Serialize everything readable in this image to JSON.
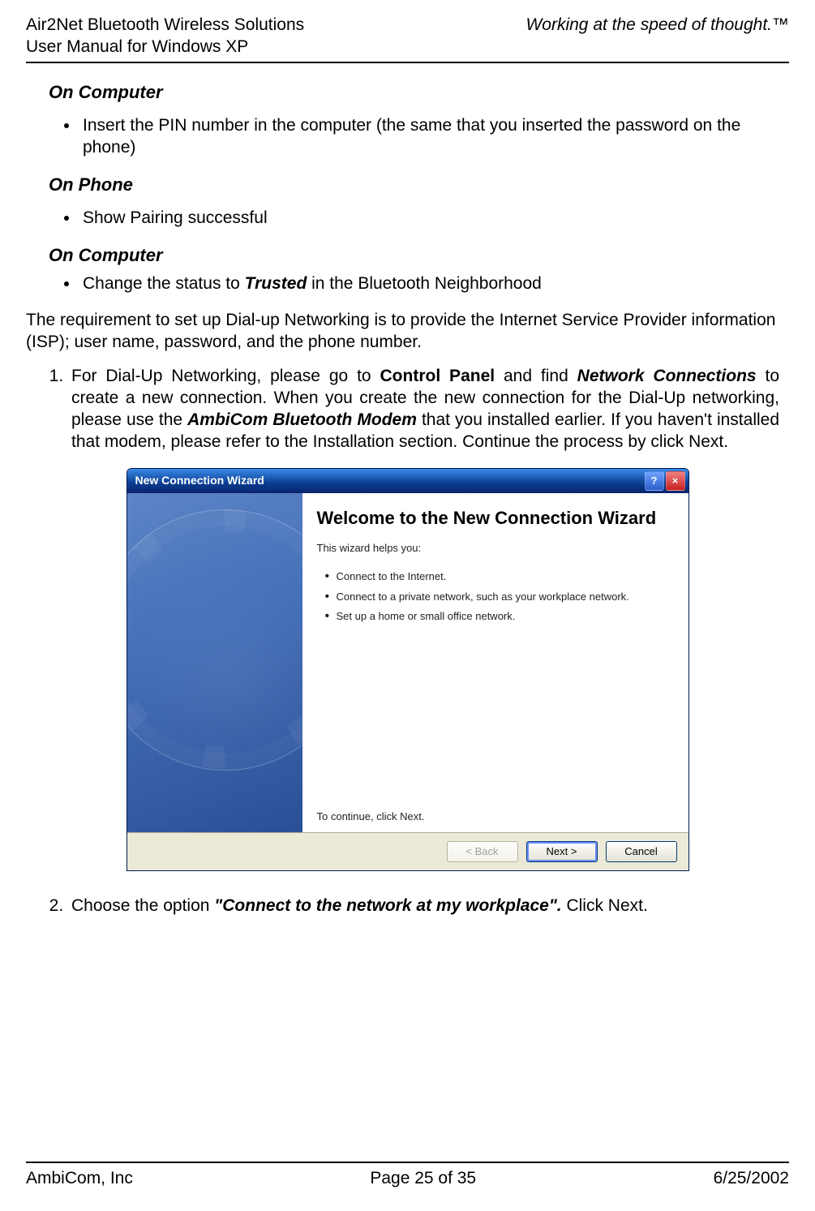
{
  "header": {
    "left_line1": "Air2Net Bluetooth Wireless Solutions",
    "left_line2": "User Manual for Windows XP",
    "right_tagline": "Working at the speed of thought.™"
  },
  "footer": {
    "company": "AmbiCom, Inc",
    "page_of": "Page 25 of 35",
    "date": "6/25/2002"
  },
  "sections": {
    "on_computer_1": "On Computer",
    "on_phone": "On Phone",
    "on_computer_2": "On Computer"
  },
  "bullets": {
    "comp1_a": "Insert the PIN number in the computer (the same that you inserted the password on the phone)",
    "phone_a": "Show Pairing successful",
    "comp2_prefix": "Change the status to ",
    "comp2_bold": "Trusted",
    "comp2_suffix": " in the Bluetooth Neighborhood"
  },
  "requirement_paragraph": "The requirement to set up Dial-up Networking is to provide the Internet Service Provider information (ISP); user name, password, and the phone number.",
  "steps": {
    "step1_a": "For Dial-Up Networking, please go to ",
    "step1_b_bold": "Control Panel",
    "step1_c": " and find ",
    "step1_d_bolditalic": "Network Connections",
    "step1_e": " to create a new connection. When you create the new connection for the Dial-Up networking, please use the ",
    "step1_f_bolditalic": "AmbiCom Bluetooth Modem",
    "step1_g": " that you installed earlier. If you haven't installed that modem, please refer to the Installation section.  Continue the process by click Next.",
    "step2_a": "Choose the option ",
    "step2_b_bolditalic": "\"Connect to the network at my workplace\".",
    "step2_c": "  Click Next."
  },
  "wizard": {
    "title": "New Connection Wizard",
    "headline": "Welcome to the New Connection Wizard",
    "intro": "This wizard helps you:",
    "items": [
      "Connect to the Internet.",
      "Connect to a private network, such as your workplace network.",
      "Set up a home or small office network."
    ],
    "continue_hint": "To continue, click Next.",
    "buttons": {
      "back": "< Back",
      "next": "Next >",
      "cancel": "Cancel"
    },
    "help_glyph": "?",
    "close_glyph": "×"
  }
}
